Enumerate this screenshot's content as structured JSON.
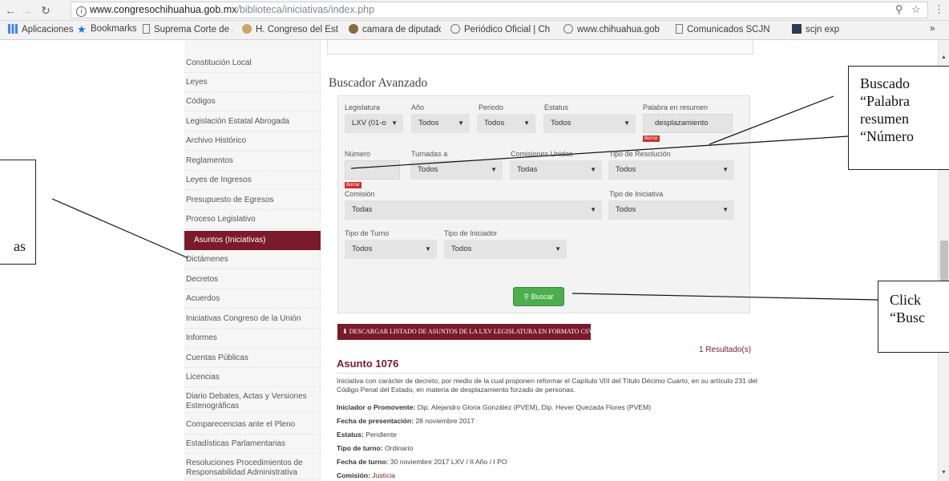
{
  "browser": {
    "url_host": "www.congresochihuahua.gob.mx",
    "url_path": "/biblioteca/iniciativas/index.php",
    "bookmarks": [
      {
        "label": "Aplicaciones",
        "icon": "apps-grid-icon"
      },
      {
        "label": "Bookmarks",
        "icon": "star-icon"
      },
      {
        "label": "Suprema Corte de Ju",
        "icon": "page-icon"
      },
      {
        "label": "H. Congreso del Esta",
        "icon": "emblem-icon"
      },
      {
        "label": "camara de diputado",
        "icon": "emblem-icon"
      },
      {
        "label": "Periódico Oficial | Ch",
        "icon": "globe-icon"
      },
      {
        "label": "www.chihuahua.gob.",
        "icon": "globe-icon"
      },
      {
        "label": "Comunicados SCJN",
        "icon": "page-icon"
      },
      {
        "label": "scjn exp",
        "icon": "flag-icon"
      }
    ],
    "more": "»"
  },
  "sidebar": {
    "items": [
      "Constitución Local",
      "Leyes",
      "Códigos",
      "Legislación Estatal Abrogada",
      "Archivo Histórico",
      "Reglamentos",
      "Leyes de Ingresos",
      "Presupuesto de Egresos",
      "Proceso Legislativo",
      "Asuntos (Iniciativas)",
      "Dictámenes",
      "Decretos",
      "Acuerdos",
      "Iniciativas Congreso de la Unión",
      "Informes",
      "Cuentas Públicas",
      "Licencias",
      "Diario Debates, Actas y Versiones Estenográficas",
      "Comparecencias ante el Pleno",
      "Estadísticas Parlamentarias",
      "Resoluciones Procedimientos de Responsabilidad Administrativa"
    ],
    "active": "Asuntos (Iniciativas)"
  },
  "search": {
    "title": "Buscador Avanzado",
    "labels": {
      "legislatura": "Legislatura",
      "anio": "Año",
      "periodo": "Periodo",
      "estatus": "Estatus",
      "palabra": "Palabra en resumen",
      "numero": "Número",
      "turnadas": "Turnadas a",
      "comisiones_unidas": "Comisiones Unidas",
      "tipo_resolucion": "Tipo de Resolución",
      "comision": "Comisión",
      "tipo_iniciativa": "Tipo de Iniciativa",
      "tipo_turno": "Tipo de Turno",
      "tipo_iniciador": "Tipo de Iniciador"
    },
    "values": {
      "legislatura": "LXV (01-o",
      "anio": "Todos",
      "periodo": "Todos",
      "estatus": "Todos",
      "palabra": "desplazamiento",
      "numero": "",
      "turnadas": "Todos",
      "comisiones_unidas": "Todas",
      "tipo_resolucion": "Todos",
      "comision": "Todas",
      "tipo_iniciativa": "Todos",
      "tipo_turno": "Todos",
      "tipo_iniciador": "Todos"
    },
    "clear_label": "Borrar",
    "button_label": "Buscar"
  },
  "download_label": "DESCARGAR LISTADO DE ASUNTOS DE LA LXV LEGISLATURA EN FORMATO CSV",
  "results_count": "1 Resultado(s)",
  "result": {
    "title": "Asunto 1076",
    "description": "Iniciativa con carácter de decreto, por medio de la cual proponen reformar el Capítulo VIII del Título Décimo Cuarto, en su artículo 231 del Código Penal del Estado, en materia de desplazamiento forzado de personas.",
    "iniciador_label": "Iniciador o Promovente:",
    "iniciador_value": "Dip. Alejandro Gloria González (PVEM), Dip. Hever Quezada Flores (PVEM)",
    "fecha_label": "Fecha de presentación:",
    "fecha_value": "28 noviembre 2017",
    "estatus_label": "Estatus:",
    "estatus_value": "Pendiente",
    "turno_label": "Tipo de turno:",
    "turno_value": "Ordinario",
    "fecha_turno_label": "Fecha de turno:",
    "fecha_turno_value": "30 noviembre 2017   LXV / II Año / I PO",
    "comision_label": "Comisión:",
    "comision_value": "Justicia"
  },
  "annotations": {
    "left_box": "as",
    "right_top_lines": [
      "Buscado",
      "“Palabra",
      "resumen",
      "“Número"
    ],
    "right_bottom_lines": [
      "Click",
      "“Busc"
    ]
  }
}
